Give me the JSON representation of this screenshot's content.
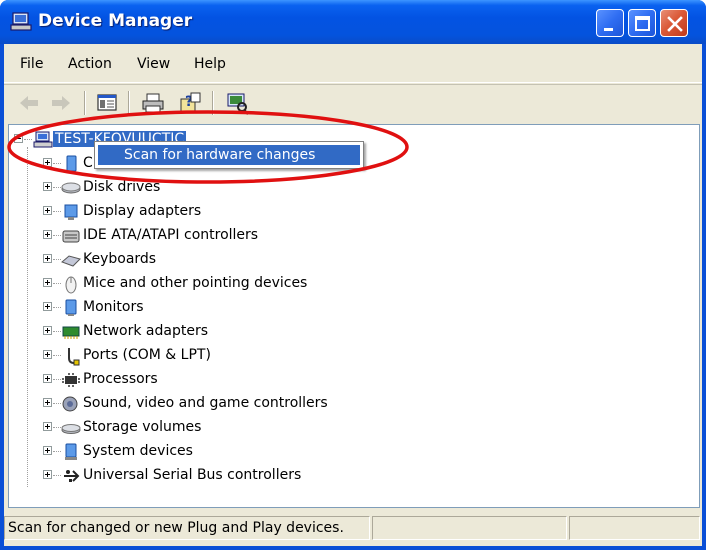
{
  "window": {
    "title": "Device Manager",
    "accent": "#0a4fd6"
  },
  "menu": {
    "items": [
      {
        "label": "File"
      },
      {
        "label": "Action"
      },
      {
        "label": "View"
      },
      {
        "label": "Help"
      }
    ]
  },
  "toolbar": {
    "icons": [
      "back-arrow-icon",
      "forward-arrow-icon",
      "show-hide-console-tree-icon",
      "print-icon",
      "help-icon",
      "scan-hardware-icon"
    ]
  },
  "tree": {
    "root": {
      "label": "TEST-KFQVUUCTIC",
      "icon": "computer-icon"
    },
    "items": [
      {
        "label": "C",
        "icon": "computer-category-icon"
      },
      {
        "label": "Disk drives",
        "icon": "disk-drive-icon"
      },
      {
        "label": "Display adapters",
        "icon": "display-adapter-icon"
      },
      {
        "label": "IDE ATA/ATAPI controllers",
        "icon": "ide-controller-icon"
      },
      {
        "label": "Keyboards",
        "icon": "keyboard-icon"
      },
      {
        "label": "Mice and other pointing devices",
        "icon": "mouse-icon"
      },
      {
        "label": "Monitors",
        "icon": "monitor-icon"
      },
      {
        "label": "Network adapters",
        "icon": "network-adapter-icon"
      },
      {
        "label": "Ports (COM & LPT)",
        "icon": "port-icon"
      },
      {
        "label": "Processors",
        "icon": "processor-icon"
      },
      {
        "label": "Sound, video and game controllers",
        "icon": "sound-icon"
      },
      {
        "label": "Storage volumes",
        "icon": "storage-volume-icon"
      },
      {
        "label": "System devices",
        "icon": "system-device-icon"
      },
      {
        "label": "Universal Serial Bus controllers",
        "icon": "usb-icon"
      }
    ]
  },
  "context_menu": {
    "items": [
      {
        "label": "Scan for hardware changes",
        "selected": true
      }
    ]
  },
  "annotation": {
    "highlight_color": "#e01010"
  },
  "status": {
    "text": "Scan for changed or new Plug and Play devices."
  }
}
